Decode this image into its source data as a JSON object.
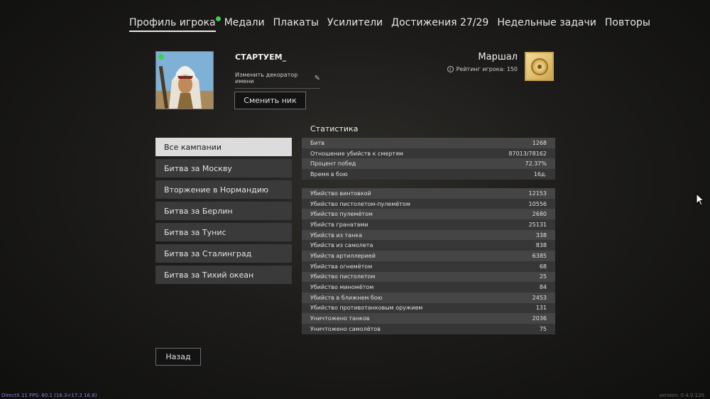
{
  "tabs": [
    {
      "label": "Профиль игрока",
      "active": true,
      "notify": true
    },
    {
      "label": "Медали"
    },
    {
      "label": "Плакаты"
    },
    {
      "label": "Усилители"
    },
    {
      "label": "Достижения 27/29"
    },
    {
      "label": "Недельные задачи"
    },
    {
      "label": "Повторы"
    }
  ],
  "profile": {
    "nickname": "СТАРТУЕМ_",
    "decorator_label": "Изменить декоратор имени",
    "change_nick_label": "Сменить ник",
    "rank": "Маршал",
    "rating_label": "Рейтинг игрока: 150"
  },
  "campaigns": [
    {
      "label": "Все кампании",
      "active": true
    },
    {
      "label": "Битва за Москву"
    },
    {
      "label": "Вторжение в Нормандию"
    },
    {
      "label": "Битва за Берлин"
    },
    {
      "label": "Битва за Тунис"
    },
    {
      "label": "Битва за Сталинград"
    },
    {
      "label": "Битва за Тихий океан"
    }
  ],
  "stats": {
    "title": "Статистика",
    "general": [
      {
        "label": "Битв",
        "value": "1268"
      },
      {
        "label": "Отношение убийств к смертям",
        "value": "87013/78162"
      },
      {
        "label": "Процент побед",
        "value": "72.37%"
      },
      {
        "label": "Время в бою",
        "value": "16д."
      }
    ],
    "kills": [
      {
        "label": "Убийство винтовкой",
        "value": "12153"
      },
      {
        "label": "Убийство пистолетом-пулемётом",
        "value": "10556"
      },
      {
        "label": "Убийство пулемётом",
        "value": "2680"
      },
      {
        "label": "Убийств гранатами",
        "value": "25131"
      },
      {
        "label": "Убийств из танка",
        "value": "338"
      },
      {
        "label": "Убийств из самолета",
        "value": "838"
      },
      {
        "label": "Убийств артиллерией",
        "value": "6385"
      },
      {
        "label": "Убийства огнемётом",
        "value": "68"
      },
      {
        "label": "Убийство пистолетом",
        "value": "25"
      },
      {
        "label": "Убийство миномётом",
        "value": "84"
      },
      {
        "label": "Убийств в ближнем бою",
        "value": "2453"
      },
      {
        "label": "Убийство противотанковым оружием",
        "value": "131"
      },
      {
        "label": "Уничтожено танков",
        "value": "2036"
      },
      {
        "label": "Уничтожено самолётов",
        "value": "75"
      }
    ]
  },
  "back_label": "Назад",
  "footer": {
    "fps": "DirectX 11 FPS: 60.1 (16.3<17.2 16.6)",
    "version": "version: 0.4.0.120"
  },
  "icons": {
    "edit": "pencil-icon",
    "info": "info-icon",
    "rank": "marshal-rank-icon",
    "notify": "notification-dot-icon"
  },
  "colors": {
    "accent_green": "#3ecf4c",
    "rank_gold": "#d8b25e",
    "active_campaign": "#dcdcdc"
  }
}
